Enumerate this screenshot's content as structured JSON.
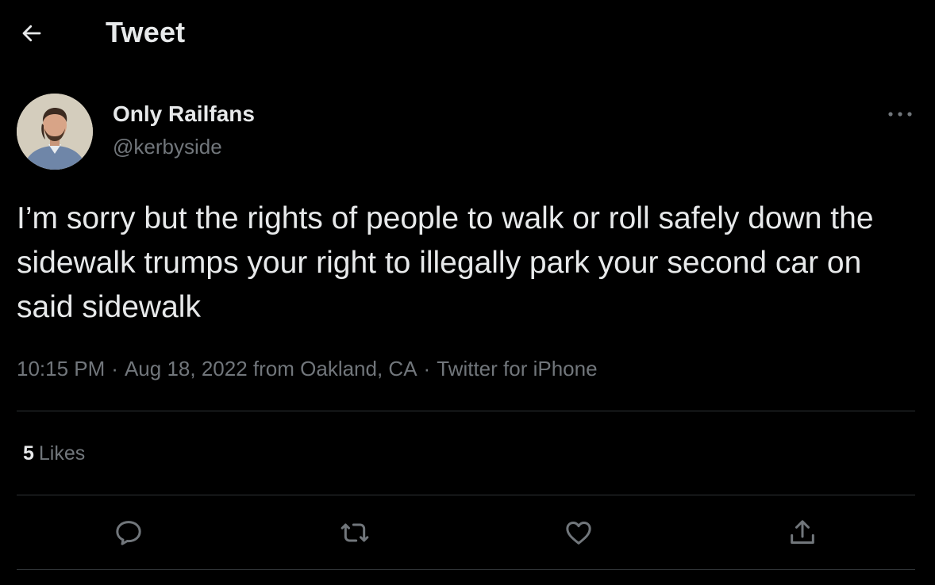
{
  "header": {
    "back_icon": "arrow-left-icon",
    "title": "Tweet"
  },
  "tweet": {
    "author": {
      "name": "Only Railfans",
      "handle": "@kerbyside",
      "avatar_icon": "profile-photo"
    },
    "more_icon": "more-horizontal-icon",
    "text": "I’m sorry but the rights of people to walk or roll safely down the sidewalk trumps your right to illegally park your second car on said sidewalk",
    "time": "10:15 PM",
    "date": "Aug 18, 2022",
    "location": "from Oakland, CA",
    "source": "Twitter for iPhone",
    "separator": "·",
    "likes_count": "5",
    "likes_label": "Likes"
  },
  "actions": {
    "reply_icon": "reply-icon",
    "retweet_icon": "retweet-icon",
    "like_icon": "heart-icon",
    "share_icon": "share-icon"
  },
  "colors": {
    "background": "#000000",
    "primary_text": "#e7e9ea",
    "secondary_text": "#71767b",
    "divider": "#2f3336"
  }
}
